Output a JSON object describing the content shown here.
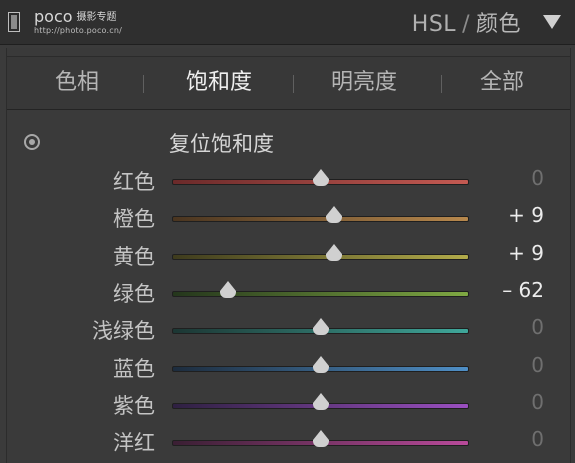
{
  "header": {
    "logo_mark": "poco",
    "logo_cn": "摄影专题",
    "logo_url": "http://photo.poco.cn/",
    "title_main": "HSL",
    "title_sep": "/",
    "title_sub": "颜色"
  },
  "tabs": [
    {
      "label": "色相",
      "active": false
    },
    {
      "label": "饱和度",
      "active": true
    },
    {
      "label": "明亮度",
      "active": false
    },
    {
      "label": "全部",
      "active": false
    }
  ],
  "reset_label": "复位饱和度",
  "sliders": [
    {
      "label": "红色",
      "value_text": "0",
      "value": 0,
      "track": "#6b2a2a,#c45a52",
      "nonzero": false
    },
    {
      "label": "橙色",
      "value_text": "+ 9",
      "value": 9,
      "track": "#4a3520,#b7884d",
      "nonzero": true
    },
    {
      "label": "黄色",
      "value_text": "+ 9",
      "value": 9,
      "track": "#3e3b1d,#b2ab4a",
      "nonzero": true
    },
    {
      "label": "绿色",
      "value_text": "– 62",
      "value": -62,
      "track": "#24361c,#7fa843",
      "nonzero": true
    },
    {
      "label": "浅绿色",
      "value_text": "0",
      "value": 0,
      "track": "#1c3633,#3fa79a",
      "nonzero": false
    },
    {
      "label": "蓝色",
      "value_text": "0",
      "value": 0,
      "track": "#1d2c3d,#4f8fc6",
      "nonzero": false
    },
    {
      "label": "紫色",
      "value_text": "0",
      "value": 0,
      "track": "#2e2041,#9a4fc0",
      "nonzero": false
    },
    {
      "label": "洋红",
      "value_text": "0",
      "value": 0,
      "track": "#3a1f33,#b84a9a",
      "nonzero": false
    }
  ]
}
